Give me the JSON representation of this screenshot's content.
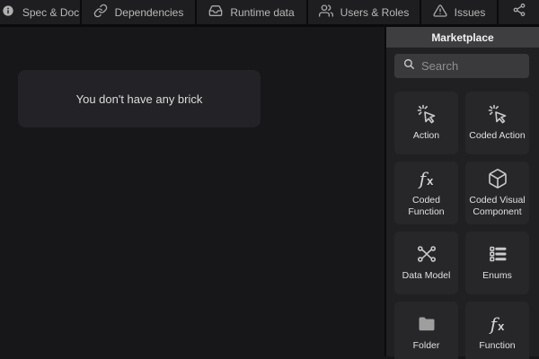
{
  "topbar": {
    "tabs": [
      {
        "label": "Spec & Doc",
        "icon": "info-icon"
      },
      {
        "label": "Dependencies",
        "icon": "link-icon"
      },
      {
        "label": "Runtime data",
        "icon": "inbox-icon"
      },
      {
        "label": "Users & Roles",
        "icon": "users-icon"
      },
      {
        "label": "Issues",
        "icon": "warning-icon"
      }
    ],
    "share_icon": "share-icon"
  },
  "main": {
    "empty_state_message": "You don't have any brick"
  },
  "sidebar": {
    "title": "Marketplace",
    "search": {
      "placeholder": "Search",
      "icon": "search-icon"
    },
    "tiles": [
      {
        "label": "Action",
        "icon": "cursor-click-icon"
      },
      {
        "label": "Coded Action",
        "icon": "cursor-click-icon"
      },
      {
        "label": "Coded Function",
        "icon": "fx-icon"
      },
      {
        "label": "Coded Visual Component",
        "icon": "cube-icon"
      },
      {
        "label": "Data Model",
        "icon": "graph-nodes-icon"
      },
      {
        "label": "Enums",
        "icon": "list-items-icon"
      },
      {
        "label": "Folder",
        "icon": "folder-icon"
      },
      {
        "label": "Function",
        "icon": "fx-icon"
      }
    ]
  },
  "colors": {
    "topbar_bg": "#1e1e20",
    "divider": "#0b0b0c",
    "main_bg": "#17171a",
    "card_bg": "#232327",
    "sidebar_bg": "#202023",
    "panel_header_bg": "#3e3e41",
    "search_bg": "#3a3a3d",
    "tile_bg": "#27272a",
    "text_primary": "#e0e0e0",
    "text_muted": "#8f8f8f"
  }
}
